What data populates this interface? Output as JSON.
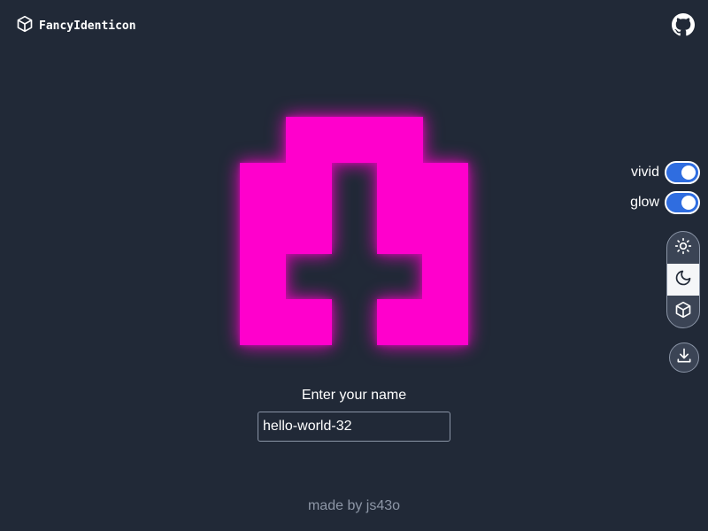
{
  "app": {
    "title": "FancyIdenticon",
    "logo_icon": "cube-icon",
    "github_icon": "github-icon"
  },
  "identicon": {
    "color": "#ff00cc",
    "grid_size": 5,
    "filled_cells": [
      [
        0,
        1
      ],
      [
        0,
        2
      ],
      [
        0,
        3
      ],
      [
        1,
        0
      ],
      [
        1,
        1
      ],
      [
        1,
        3
      ],
      [
        1,
        4
      ],
      [
        2,
        0
      ],
      [
        2,
        1
      ],
      [
        2,
        3
      ],
      [
        2,
        4
      ],
      [
        3,
        0
      ],
      [
        3,
        4
      ],
      [
        4,
        0
      ],
      [
        4,
        1
      ],
      [
        4,
        3
      ],
      [
        4,
        4
      ]
    ]
  },
  "controls": {
    "vivid_label": "vivid",
    "vivid_on": true,
    "glow_label": "glow",
    "glow_on": true,
    "theme_options": [
      "light",
      "dark",
      "system"
    ],
    "theme_selected": "dark",
    "download_icon": "download-icon"
  },
  "form": {
    "label": "Enter your name",
    "value": "hello-world-32"
  },
  "footer": {
    "text": "made by js43o"
  },
  "colors": {
    "background": "#212937",
    "accent": "#2f6de0"
  }
}
